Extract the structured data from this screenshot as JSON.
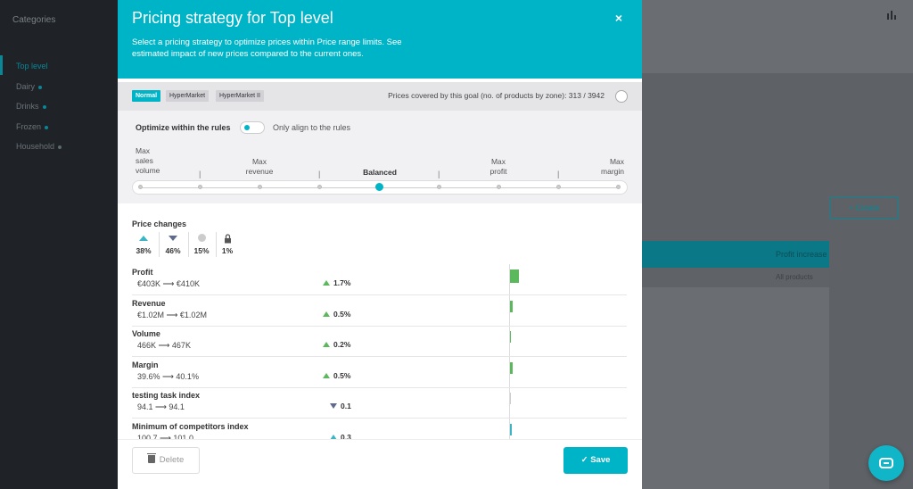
{
  "background": {
    "sidebar_title": "Categories",
    "sidebar_items": [
      "Top level",
      "Dairy",
      "Drinks",
      "Frozen",
      "Household"
    ],
    "create_label": "+ Create",
    "card_title": "Profit increase",
    "card_sub": "All products"
  },
  "modal": {
    "title": "Pricing strategy for Top level",
    "description": "Select a pricing strategy to optimize prices within Price range limits. See estimated impact of new prices compared to the current ones.",
    "close_icon": "×",
    "zones": [
      "Normal",
      "HyperMarket",
      "HyperMarket II"
    ],
    "covered_text": "Prices covered by this goal (no. of products by zone): 313 / 3942",
    "optimize_label": "Optimize within the rules",
    "align_label": "Only align to the rules",
    "goals": {
      "max_sales_volume": [
        "Max",
        "sales",
        "volume"
      ],
      "max_revenue": [
        "Max",
        "revenue"
      ],
      "balanced": "Balanced",
      "max_profit": [
        "Max",
        "profit"
      ],
      "max_margin": [
        "Max",
        "margin"
      ]
    },
    "separator": "|",
    "price_changes_label": "Price changes",
    "price_changes": {
      "up": "38%",
      "down": "46%",
      "neutral": "15%",
      "locked": "1%"
    },
    "metrics": [
      {
        "name": "Profit",
        "range": "€403K ⟶ €410K",
        "change": "1.7%",
        "dir": "up",
        "color": "#5cb85c",
        "bar": 1.7
      },
      {
        "name": "Revenue",
        "range": "€1.02M ⟶ €1.02M",
        "change": "0.5%",
        "dir": "up",
        "color": "#5cb85c",
        "bar": 0.5
      },
      {
        "name": "Volume",
        "range": "466K ⟶ 467K",
        "change": "0.2%",
        "dir": "up",
        "color": "#5cb85c",
        "bar": 0.2
      },
      {
        "name": "Margin",
        "range": "39.6% ⟶ 40.1%",
        "change": "0.5%",
        "dir": "up",
        "color": "#5cb85c",
        "bar": 0.5
      },
      {
        "name": "testing task index",
        "range": "94.1 ⟶ 94.1",
        "change": "0.1",
        "dir": "down",
        "color": "#5f6b8a",
        "bar": 0.0
      },
      {
        "name": "Minimum of competitors index",
        "range": "100.7 ⟶ 101.0",
        "change": "0.3",
        "dir": "up",
        "color": "#3bb5c5",
        "bar": 0.3
      }
    ],
    "delete_label": "Delete",
    "save_label": "Save"
  }
}
